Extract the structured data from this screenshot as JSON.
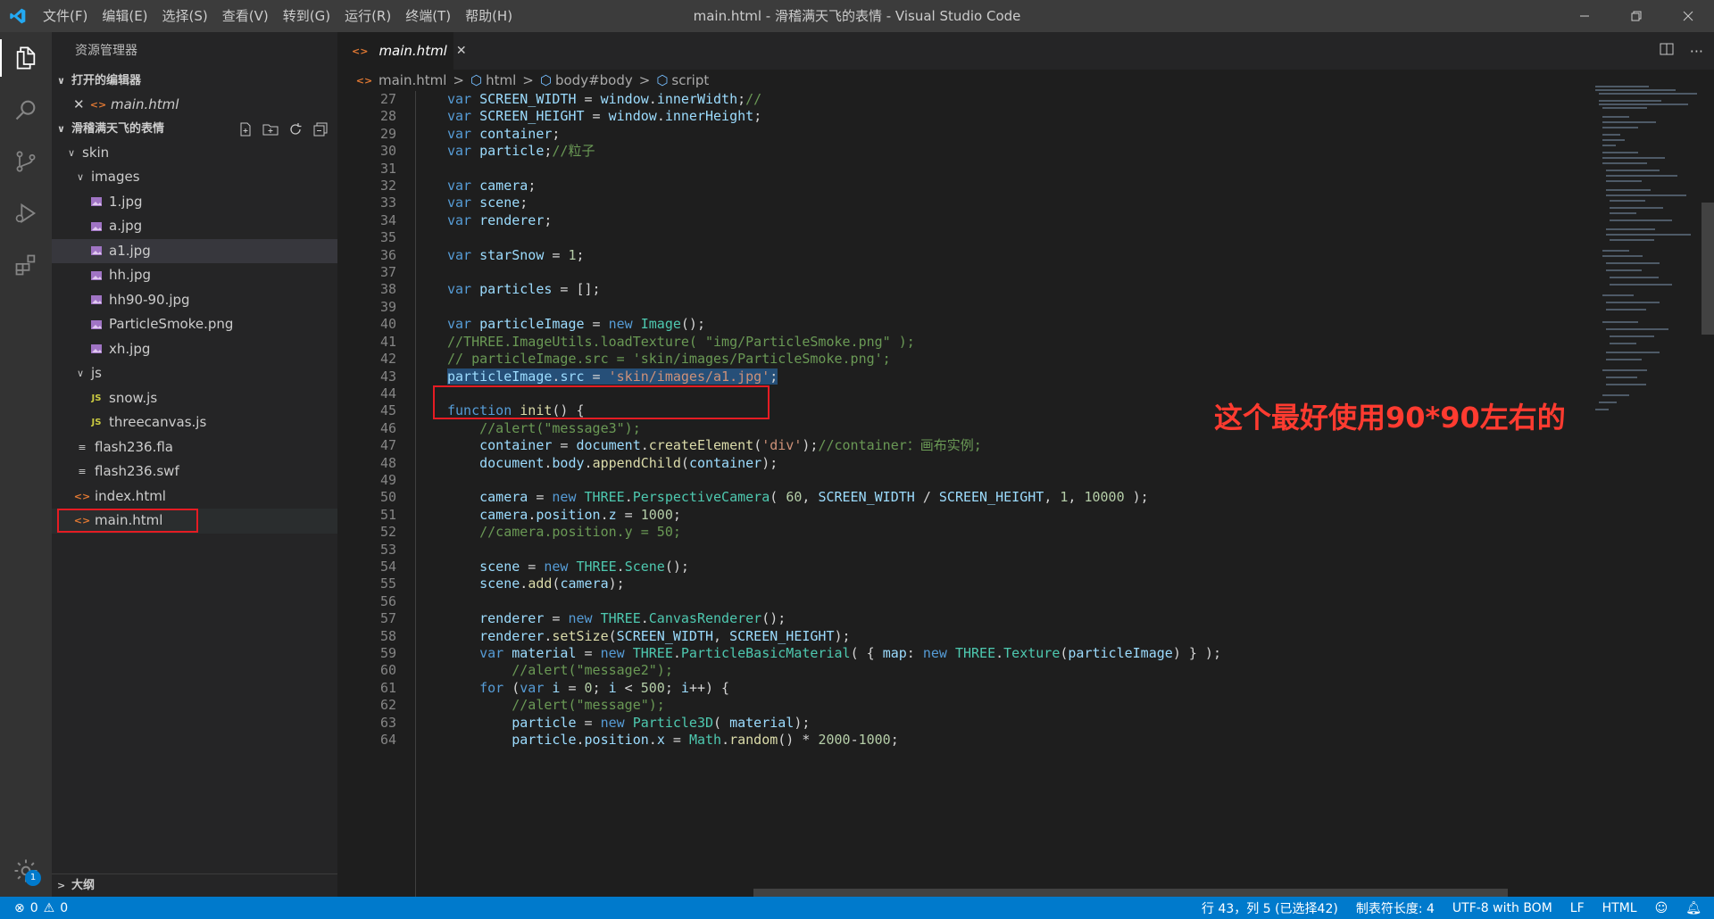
{
  "titlebar": {
    "menus": [
      "文件(F)",
      "编辑(E)",
      "选择(S)",
      "查看(V)",
      "转到(G)",
      "运行(R)",
      "终端(T)",
      "帮助(H)"
    ],
    "title": "main.html - 滑稽满天飞的表情 - Visual Studio Code",
    "icons": [
      "vscode-logo",
      "minimize-icon",
      "restore-icon",
      "close-icon"
    ]
  },
  "activitybar": {
    "items": [
      "explorer-icon",
      "search-icon",
      "source-control-icon",
      "run-debug-icon",
      "extensions-icon"
    ],
    "settings_badge": "1"
  },
  "sidebar": {
    "title": "资源管理器",
    "open_editors_label": "打开的编辑器",
    "open_editor_file": "main.html",
    "folder_label": "滑稽满天飞的表情",
    "tree": {
      "skin": "skin",
      "images": "images",
      "files_images": [
        "1.jpg",
        "a.jpg",
        "a1.jpg",
        "hh.jpg",
        "hh90-90.jpg",
        "ParticleSmoke.png",
        "xh.jpg"
      ],
      "js": "js",
      "files_js": [
        "snow.js",
        "threecanvas.js"
      ],
      "root_files": [
        "flash236.fla",
        "flash236.swf",
        "index.html",
        "main.html"
      ]
    },
    "outline_label": "大纲"
  },
  "editor": {
    "tab_label": "main.html",
    "breadcrumbs": [
      "main.html",
      "html",
      "body#body",
      "script"
    ],
    "annotation": "这个最好使用90*90左右的",
    "line_numbers": [
      "27",
      "28",
      "29",
      "30",
      "31",
      "32",
      "33",
      "34",
      "35",
      "36",
      "37",
      "38",
      "39",
      "40",
      "41",
      "42",
      "43",
      "44",
      "45",
      "46",
      "47",
      "48",
      "49",
      "50",
      "51",
      "52",
      "53",
      "54",
      "55",
      "56",
      "57",
      "58",
      "59",
      "60",
      "61",
      "62",
      "63",
      "64"
    ]
  },
  "statusbar": {
    "errors": "0",
    "warnings": "0",
    "position": "行 43，列 5 (已选择42)",
    "tab_size": "制表符长度: 4",
    "encoding": "UTF-8 with BOM",
    "eol": "LF",
    "language": "HTML"
  }
}
